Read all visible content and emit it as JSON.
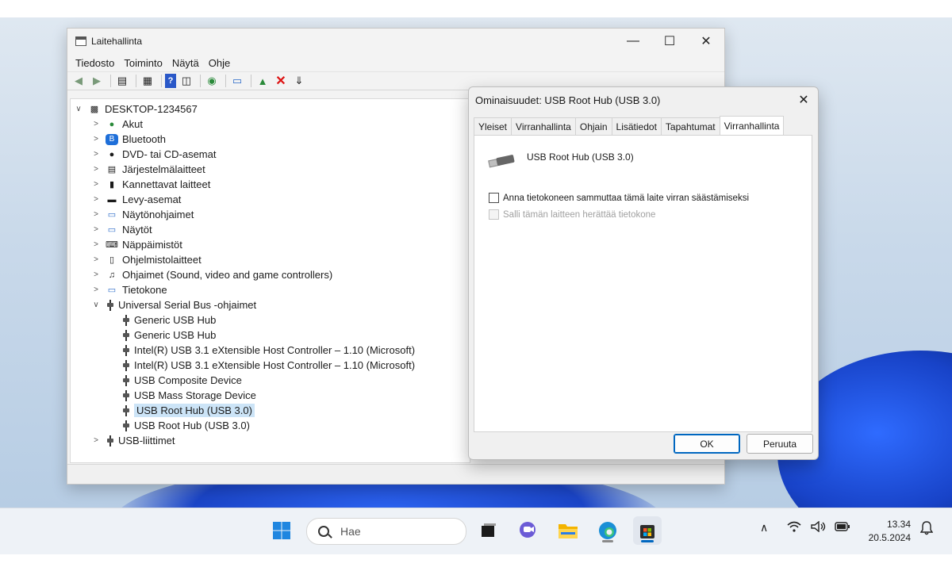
{
  "devmgr": {
    "title": "Laitehallinta",
    "menu": [
      "Tiedosto",
      "Toiminto",
      "Näytä",
      "Ohje"
    ],
    "root": "DESKTOP-1234567",
    "categories": [
      {
        "label": "Akut",
        "icon": "battery-icon"
      },
      {
        "label": "Bluetooth",
        "icon": "bluetooth-icon"
      },
      {
        "label": "DVD- tai CD-asemat",
        "icon": "dvd-drive-icon"
      },
      {
        "label": "Järjestelmälaitteet",
        "icon": "system-devices-icon"
      },
      {
        "label": "Kannettavat laitteet",
        "icon": "portable-devices-icon"
      },
      {
        "label": "Levy-asemat",
        "icon": "disk-drive-icon"
      },
      {
        "label": "Näytönohjaimet",
        "icon": "display-adapter-icon"
      },
      {
        "label": "Näytöt",
        "icon": "monitor-icon"
      },
      {
        "label": "Näppäimistöt",
        "icon": "keyboard-icon"
      },
      {
        "label": "Ohjelmistolaitteet",
        "icon": "software-device-icon"
      },
      {
        "label": "Ohjaimet (Sound, video and game controllers)",
        "icon": "sound-icon"
      },
      {
        "label": "Tietokone",
        "icon": "computer-icon"
      },
      {
        "label": "Universal Serial Bus -ohjaimet",
        "icon": "usb-icon"
      }
    ],
    "usb_children": [
      "Generic USB Hub",
      "Generic USB Hub",
      "Intel(R) USB 3.1 eXtensible Host Controller – 1.10 (Microsoft)",
      "Intel(R) USB 3.1 eXtensible Host Controller – 1.10 (Microsoft)",
      "USB Composite Device",
      "USB Mass Storage Device",
      "USB Root Hub (USB 3.0)",
      "USB Root Hub (USB 3.0)"
    ],
    "selected_child_index": 6,
    "last_category": "USB-liittimet"
  },
  "dialog": {
    "title": "Ominaisuudet: USB Root Hub (USB 3.0)",
    "tabs": [
      "Yleiset",
      "Virranhallinta",
      "Ohjain",
      "Lisätiedot",
      "Tapahtumat",
      "Virranhallinta"
    ],
    "active_tab": 5,
    "device_name": "USB Root Hub (USB 3.0)",
    "checkbox1": "Anna tietokoneen sammuttaa tämä laite virran säästämiseksi",
    "checkbox2": "Salli tämän laitteen herättää tietokone",
    "ok": "OK",
    "cancel": "Peruuta"
  },
  "taskbar": {
    "search_placeholder": "Hae",
    "time": "13.34",
    "date": "20.5.2024"
  }
}
